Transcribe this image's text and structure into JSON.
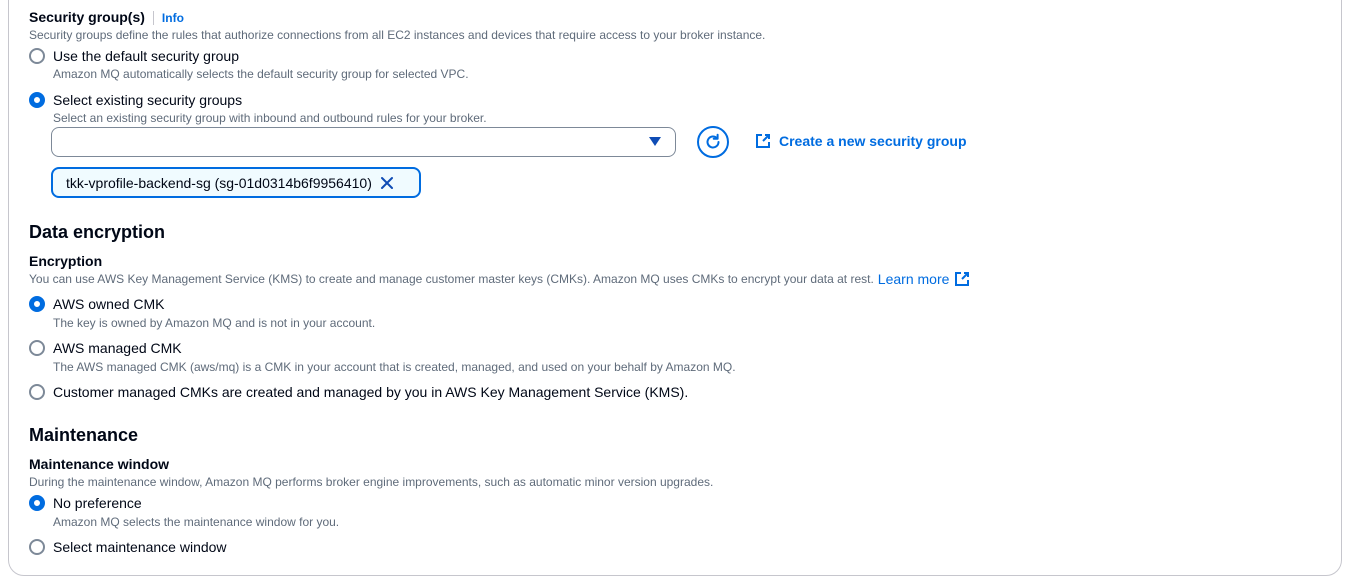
{
  "security": {
    "title": "Security group(s)",
    "info": "Info",
    "description": "Security groups define the rules that authorize connections from all EC2 instances and devices that require access to your broker instance.",
    "options": [
      {
        "label": "Use the default security group",
        "desc": "Amazon MQ automatically selects the default security group for selected VPC.",
        "selected": false
      },
      {
        "label": "Select existing security groups",
        "desc": "Select an existing security group with inbound and outbound rules for your broker.",
        "selected": true
      }
    ],
    "select_value": "",
    "create_link": "Create a new security group",
    "token": "tkk-vprofile-backend-sg (sg-01d0314b6f9956410)"
  },
  "encryption": {
    "heading": "Data encryption",
    "label": "Encryption",
    "description": "You can use AWS Key Management Service (KMS) to create and manage customer master keys (CMKs). Amazon MQ uses CMKs to encrypt your data at rest.",
    "learn_more": "Learn more",
    "options": [
      {
        "label": "AWS owned CMK",
        "desc": "The key is owned by Amazon MQ and is not in your account.",
        "selected": true
      },
      {
        "label": "AWS managed CMK",
        "desc": "The AWS managed CMK (aws/mq) is a CMK in your account that is created, managed, and used on your behalf by Amazon MQ.",
        "selected": false
      },
      {
        "label": "Customer managed CMKs are created and managed by you in AWS Key Management Service (KMS).",
        "desc": "",
        "selected": false
      }
    ]
  },
  "maintenance": {
    "heading": "Maintenance",
    "label": "Maintenance window",
    "description": "During the maintenance window, Amazon MQ performs broker engine improvements, such as automatic minor version upgrades.",
    "options": [
      {
        "label": "No preference",
        "desc": "Amazon MQ selects the maintenance window for you.",
        "selected": true
      },
      {
        "label": "Select maintenance window",
        "desc": "",
        "selected": false
      }
    ]
  },
  "colors": {
    "accent": "#006ce0",
    "text": "#000716",
    "muted": "#5f6b7a",
    "border": "#c6c6cd"
  }
}
